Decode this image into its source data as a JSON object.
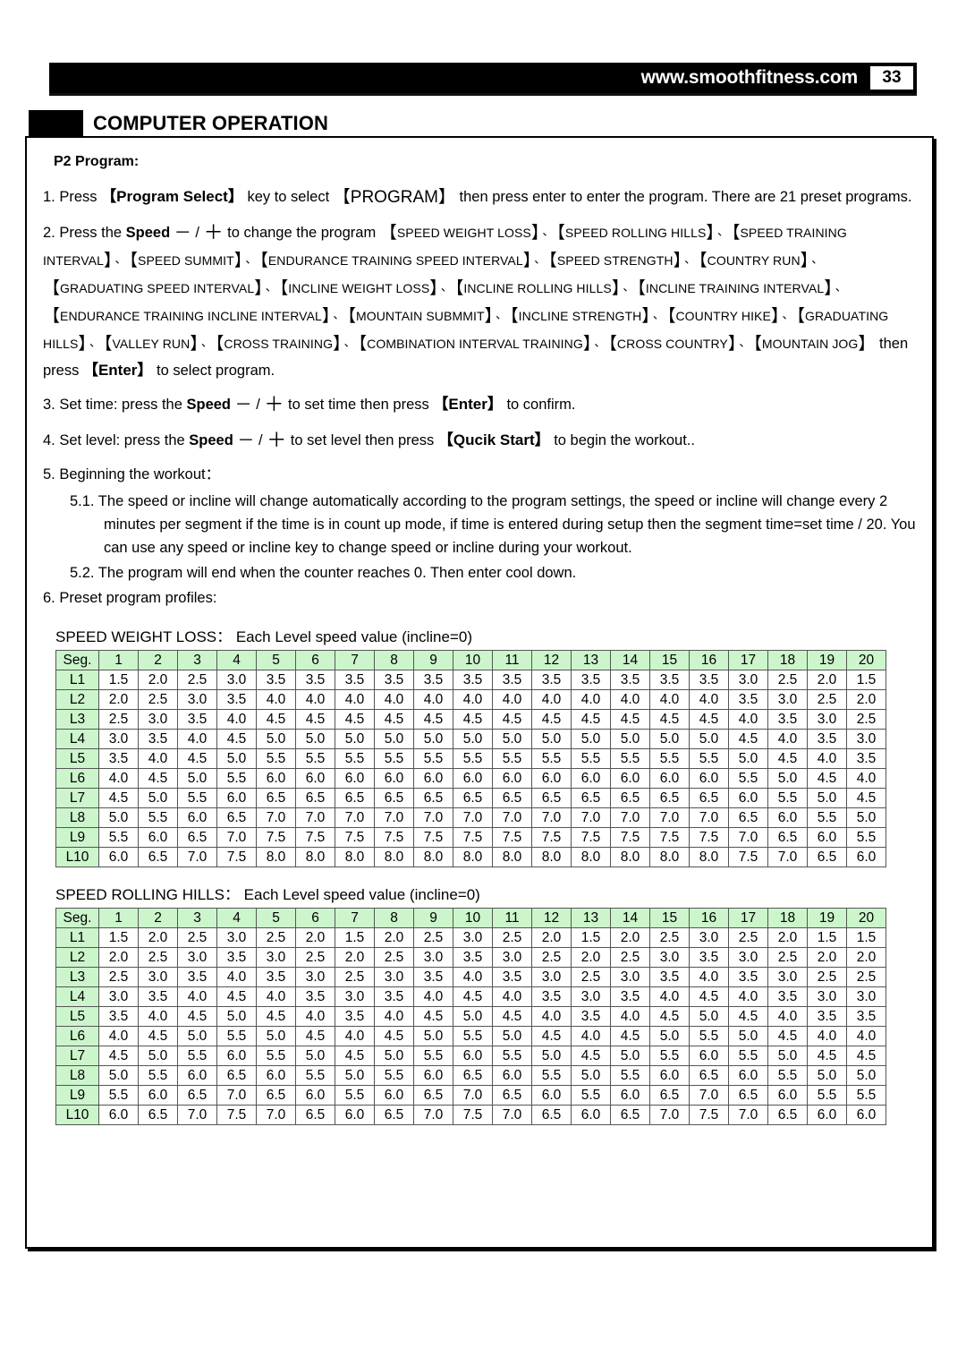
{
  "header": {
    "site_url": "www.smoothfitness.com",
    "page_number": "33",
    "section_title": "COMPUTER OPERATION"
  },
  "content": {
    "subhead": "P2 Program:",
    "step1": {
      "prefix": "1. Press",
      "key1": "【Program Select】",
      "mid1": "key to select",
      "key2": "【PROGRAM】",
      "mid2": "then press enter to enter the program. There are 21 preset programs."
    },
    "step2": {
      "prefix": "2. Press the",
      "speed": "Speed",
      "minus": "－",
      "slash": "/",
      "plus": "＋",
      "mid": "to change the program",
      "programs": [
        "SPEED WEIGHT LOSS",
        "SPEED ROLLING HILLS",
        "SPEED TRAINING INTERVAL",
        "SPEED SUMMIT",
        "ENDURANCE TRAINING SPEED INTERVAL",
        "SPEED STRENGTH",
        "COUNTRY RUN",
        "GRADUATING SPEED INTERVAL",
        "INCLINE WEIGHT LOSS",
        "INCLINE ROLLING HILLS",
        "INCLINE TRAINING INTERVAL",
        "ENDURANCE TRAINING INCLINE INTERVAL",
        "MOUNTAIN SUBMMIT",
        "INCLINE STRENGTH",
        "COUNTRY HIKE",
        "GRADUATING HILLS",
        "VALLEY RUN",
        "CROSS TRAINING",
        "COMBINATION INTERVAL TRAINING",
        "CROSS COUNTRY",
        "MOUNTAIN JOG"
      ],
      "suffix_pre": "then press",
      "enter_key": "【Enter】",
      "suffix_post": "to select program."
    },
    "step3": {
      "prefix": "3. Set time: press the",
      "speed": "Speed",
      "minus": "－",
      "slash": "/",
      "plus": "＋",
      "mid": "to set time then press",
      "key": "【Enter】",
      "suffix": "to confirm."
    },
    "step4": {
      "prefix": "4. Set level: press the",
      "speed": "Speed",
      "minus": "－",
      "slash": "/",
      "plus": "＋",
      "mid": "to set level then press",
      "key": "【Qucik Start】",
      "suffix": "to begin the workout.."
    },
    "step5": "5. Beginning the workout：",
    "step5_1": "5.1. The speed or incline will change automatically according to the program settings, the speed or incline will change every 2 minutes per segment if the time is in count up mode, if time is entered during setup then the segment time=set time / 20. You can use any speed or incline key to change speed or incline during your workout.",
    "step5_2": "5.2. The program will end when the counter reaches 0. Then enter cool down.",
    "step6": "6. Preset program profiles:"
  },
  "colors": {
    "header_green": "#ccf5cc",
    "bar_black": "#000000",
    "grid_line": "#555555"
  },
  "chart_data": [
    {
      "type": "table",
      "title": "SPEED WEIGHT LOSS： Each Level speed value (incline=0)",
      "corner_label": "Seg.",
      "categories": [
        "1",
        "2",
        "3",
        "4",
        "5",
        "6",
        "7",
        "8",
        "9",
        "10",
        "11",
        "12",
        "13",
        "14",
        "15",
        "16",
        "17",
        "18",
        "19",
        "20"
      ],
      "xlabel": "Segment",
      "ylabel": "Level",
      "series": [
        {
          "name": "L1",
          "values": [
            1.5,
            2.0,
            2.5,
            3.0,
            3.5,
            3.5,
            3.5,
            3.5,
            3.5,
            3.5,
            3.5,
            3.5,
            3.5,
            3.5,
            3.5,
            3.5,
            3.0,
            2.5,
            2.0,
            1.5
          ]
        },
        {
          "name": "L2",
          "values": [
            2.0,
            2.5,
            3.0,
            3.5,
            4.0,
            4.0,
            4.0,
            4.0,
            4.0,
            4.0,
            4.0,
            4.0,
            4.0,
            4.0,
            4.0,
            4.0,
            3.5,
            3.0,
            2.5,
            2.0
          ]
        },
        {
          "name": "L3",
          "values": [
            2.5,
            3.0,
            3.5,
            4.0,
            4.5,
            4.5,
            4.5,
            4.5,
            4.5,
            4.5,
            4.5,
            4.5,
            4.5,
            4.5,
            4.5,
            4.5,
            4.0,
            3.5,
            3.0,
            2.5
          ]
        },
        {
          "name": "L4",
          "values": [
            3.0,
            3.5,
            4.0,
            4.5,
            5.0,
            5.0,
            5.0,
            5.0,
            5.0,
            5.0,
            5.0,
            5.0,
            5.0,
            5.0,
            5.0,
            5.0,
            4.5,
            4.0,
            3.5,
            3.0
          ]
        },
        {
          "name": "L5",
          "values": [
            3.5,
            4.0,
            4.5,
            5.0,
            5.5,
            5.5,
            5.5,
            5.5,
            5.5,
            5.5,
            5.5,
            5.5,
            5.5,
            5.5,
            5.5,
            5.5,
            5.0,
            4.5,
            4.0,
            3.5
          ]
        },
        {
          "name": "L6",
          "values": [
            4.0,
            4.5,
            5.0,
            5.5,
            6.0,
            6.0,
            6.0,
            6.0,
            6.0,
            6.0,
            6.0,
            6.0,
            6.0,
            6.0,
            6.0,
            6.0,
            5.5,
            5.0,
            4.5,
            4.0
          ]
        },
        {
          "name": "L7",
          "values": [
            4.5,
            5.0,
            5.5,
            6.0,
            6.5,
            6.5,
            6.5,
            6.5,
            6.5,
            6.5,
            6.5,
            6.5,
            6.5,
            6.5,
            6.5,
            6.5,
            6.0,
            5.5,
            5.0,
            4.5
          ]
        },
        {
          "name": "L8",
          "values": [
            5.0,
            5.5,
            6.0,
            6.5,
            7.0,
            7.0,
            7.0,
            7.0,
            7.0,
            7.0,
            7.0,
            7.0,
            7.0,
            7.0,
            7.0,
            7.0,
            6.5,
            6.0,
            5.5,
            5.0
          ]
        },
        {
          "name": "L9",
          "values": [
            5.5,
            6.0,
            6.5,
            7.0,
            7.5,
            7.5,
            7.5,
            7.5,
            7.5,
            7.5,
            7.5,
            7.5,
            7.5,
            7.5,
            7.5,
            7.5,
            7.0,
            6.5,
            6.0,
            5.5
          ]
        },
        {
          "name": "L10",
          "values": [
            6.0,
            6.5,
            7.0,
            7.5,
            8.0,
            8.0,
            8.0,
            8.0,
            8.0,
            8.0,
            8.0,
            8.0,
            8.0,
            8.0,
            8.0,
            8.0,
            7.5,
            7.0,
            6.5,
            6.0
          ]
        }
      ]
    },
    {
      "type": "table",
      "title": "SPEED ROLLING HILLS： Each Level speed value (incline=0)",
      "corner_label": "Seg.",
      "categories": [
        "1",
        "2",
        "3",
        "4",
        "5",
        "6",
        "7",
        "8",
        "9",
        "10",
        "11",
        "12",
        "13",
        "14",
        "15",
        "16",
        "17",
        "18",
        "19",
        "20"
      ],
      "xlabel": "Segment",
      "ylabel": "Level",
      "series": [
        {
          "name": "L1",
          "values": [
            1.5,
            2.0,
            2.5,
            3.0,
            2.5,
            2.0,
            1.5,
            2.0,
            2.5,
            3.0,
            2.5,
            2.0,
            1.5,
            2.0,
            2.5,
            3.0,
            2.5,
            2.0,
            1.5,
            1.5
          ]
        },
        {
          "name": "L2",
          "values": [
            2.0,
            2.5,
            3.0,
            3.5,
            3.0,
            2.5,
            2.0,
            2.5,
            3.0,
            3.5,
            3.0,
            2.5,
            2.0,
            2.5,
            3.0,
            3.5,
            3.0,
            2.5,
            2.0,
            2.0
          ]
        },
        {
          "name": "L3",
          "values": [
            2.5,
            3.0,
            3.5,
            4.0,
            3.5,
            3.0,
            2.5,
            3.0,
            3.5,
            4.0,
            3.5,
            3.0,
            2.5,
            3.0,
            3.5,
            4.0,
            3.5,
            3.0,
            2.5,
            2.5
          ]
        },
        {
          "name": "L4",
          "values": [
            3.0,
            3.5,
            4.0,
            4.5,
            4.0,
            3.5,
            3.0,
            3.5,
            4.0,
            4.5,
            4.0,
            3.5,
            3.0,
            3.5,
            4.0,
            4.5,
            4.0,
            3.5,
            3.0,
            3.0
          ]
        },
        {
          "name": "L5",
          "values": [
            3.5,
            4.0,
            4.5,
            5.0,
            4.5,
            4.0,
            3.5,
            4.0,
            4.5,
            5.0,
            4.5,
            4.0,
            3.5,
            4.0,
            4.5,
            5.0,
            4.5,
            4.0,
            3.5,
            3.5
          ]
        },
        {
          "name": "L6",
          "values": [
            4.0,
            4.5,
            5.0,
            5.5,
            5.0,
            4.5,
            4.0,
            4.5,
            5.0,
            5.5,
            5.0,
            4.5,
            4.0,
            4.5,
            5.0,
            5.5,
            5.0,
            4.5,
            4.0,
            4.0
          ]
        },
        {
          "name": "L7",
          "values": [
            4.5,
            5.0,
            5.5,
            6.0,
            5.5,
            5.0,
            4.5,
            5.0,
            5.5,
            6.0,
            5.5,
            5.0,
            4.5,
            5.0,
            5.5,
            6.0,
            5.5,
            5.0,
            4.5,
            4.5
          ]
        },
        {
          "name": "L8",
          "values": [
            5.0,
            5.5,
            6.0,
            6.5,
            6.0,
            5.5,
            5.0,
            5.5,
            6.0,
            6.5,
            6.0,
            5.5,
            5.0,
            5.5,
            6.0,
            6.5,
            6.0,
            5.5,
            5.0,
            5.0
          ]
        },
        {
          "name": "L9",
          "values": [
            5.5,
            6.0,
            6.5,
            7.0,
            6.5,
            6.0,
            5.5,
            6.0,
            6.5,
            7.0,
            6.5,
            6.0,
            5.5,
            6.0,
            6.5,
            7.0,
            6.5,
            6.0,
            5.5,
            5.5
          ]
        },
        {
          "name": "L10",
          "values": [
            6.0,
            6.5,
            7.0,
            7.5,
            7.0,
            6.5,
            6.0,
            6.5,
            7.0,
            7.5,
            7.0,
            6.5,
            6.0,
            6.5,
            7.0,
            7.5,
            7.0,
            6.5,
            6.0,
            6.0
          ]
        }
      ]
    }
  ]
}
